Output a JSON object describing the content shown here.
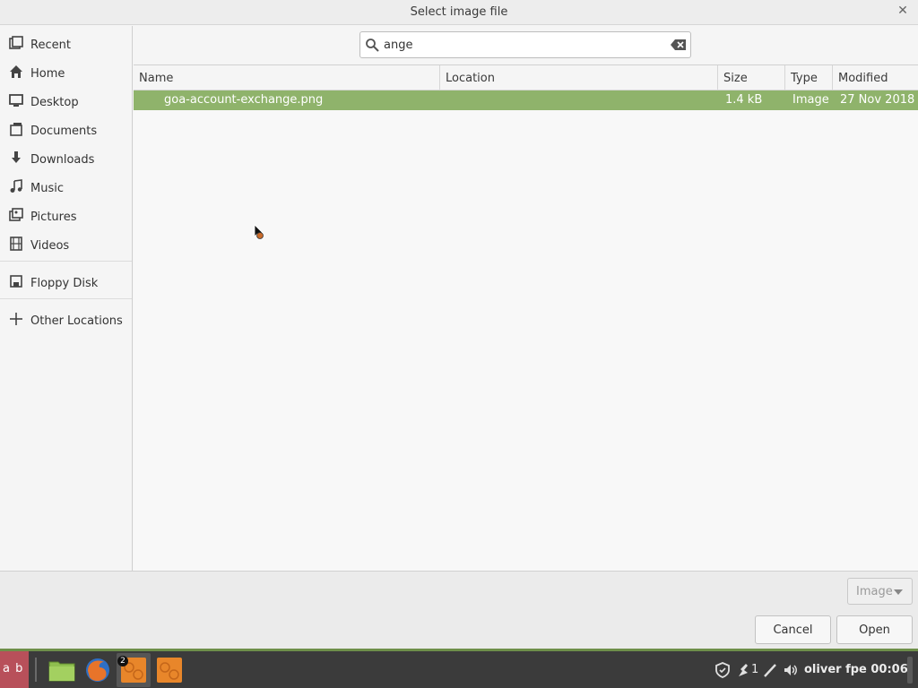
{
  "dialog": {
    "title": "Select image file",
    "close_icon": "close-icon"
  },
  "sidebar": {
    "items": [
      {
        "label": "Recent",
        "icon": "recent-icon"
      },
      {
        "label": "Home",
        "icon": "home-icon"
      },
      {
        "label": "Desktop",
        "icon": "desktop-icon"
      },
      {
        "label": "Documents",
        "icon": "documents-icon"
      },
      {
        "label": "Downloads",
        "icon": "downloads-icon"
      },
      {
        "label": "Music",
        "icon": "music-icon"
      },
      {
        "label": "Pictures",
        "icon": "pictures-icon"
      },
      {
        "label": "Videos",
        "icon": "videos-icon"
      },
      {
        "label": "Floppy Disk",
        "icon": "floppy-icon"
      },
      {
        "label": "Other Locations",
        "icon": "plus-icon"
      }
    ]
  },
  "search": {
    "value": "ange",
    "icon": "search-icon"
  },
  "file_list": {
    "columns": [
      "Name",
      "Location",
      "Size",
      "Type",
      "Modified"
    ],
    "rows": [
      {
        "name": "goa-account-exchange.png",
        "location": "",
        "size": "1.4 kB",
        "type": "Image",
        "modified": "27 Nov 2018",
        "selected": true
      }
    ]
  },
  "footer": {
    "filter_label": "Image",
    "cancel_label": "Cancel",
    "open_label": "Open"
  },
  "taskbar": {
    "menu_label": "a b",
    "badge_count": "2",
    "tray_count": "1",
    "clock": "oliver fpe 00:06"
  },
  "colors": {
    "selection": "#8fb36b",
    "taskbar": "#3b3b3b",
    "menu_button": "#b8505a",
    "accent_line": "#6e8f4a"
  }
}
